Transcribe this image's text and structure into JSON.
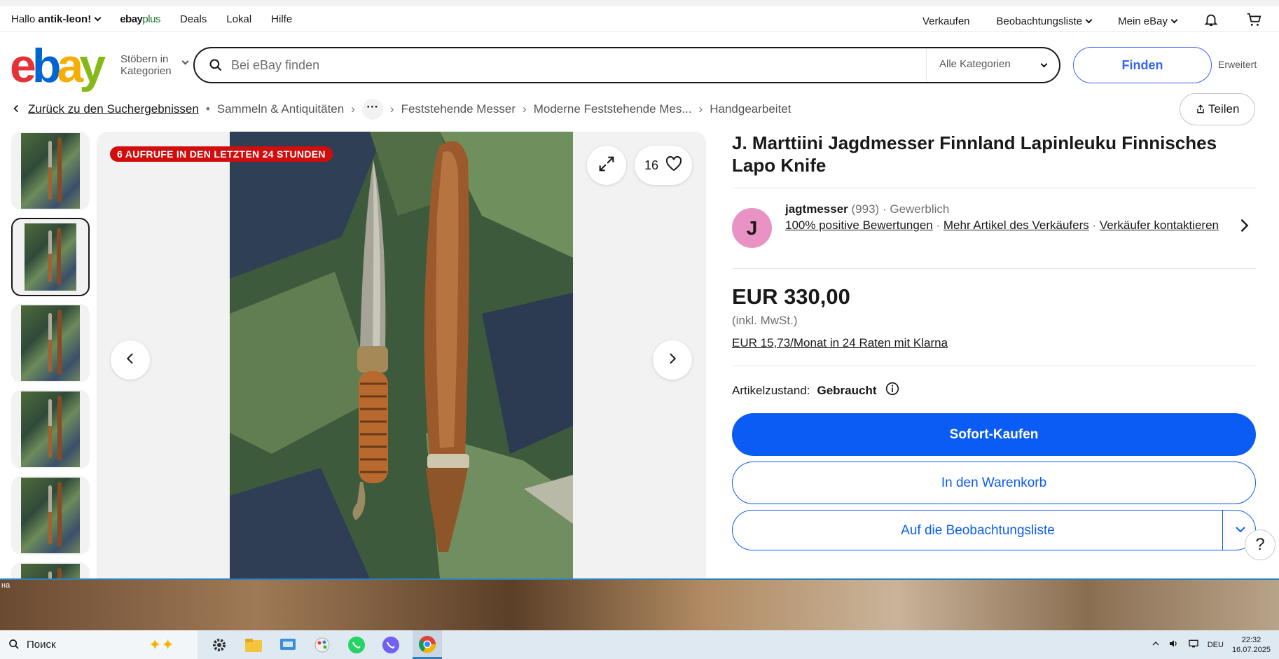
{
  "topbar": {
    "greeting": "Hallo",
    "username": "antik-leon!",
    "ebayplus": "ebay",
    "ebayplus_suffix": "plus",
    "links": [
      "Deals",
      "Lokal",
      "Hilfe"
    ],
    "sell": "Verkaufen",
    "watchlist": "Beobachtungsliste",
    "my_ebay": "Mein eBay"
  },
  "header": {
    "logo_letters": [
      "e",
      "b",
      "a",
      "y"
    ],
    "browse_line1": "Stöbern in",
    "browse_line2": "Kategorien",
    "search_placeholder": "Bei eBay finden",
    "category": "Alle Kategorien",
    "search_button": "Finden",
    "advanced": "Erweitert"
  },
  "breadcrumb": {
    "back": "Zurück zu den Suchergebnissen",
    "items": [
      "Sammeln & Antiquitäten",
      "Feststehende Messer",
      "Moderne Feststehende Mes...",
      "Handgearbeitet"
    ],
    "more": "···",
    "share": "Teilen"
  },
  "gallery": {
    "views_badge": "6 AUFRUFE IN DEN LETZTEN 24 STUNDEN",
    "watch_count": "16",
    "thumbnail_count": 6,
    "selected_thumbnail": 2
  },
  "listing": {
    "title": "J. Marttiini Jagdmesser Finnland Lapinleuku Finnisches Lapo Knife",
    "seller": {
      "initial": "J",
      "name": "jagtmesser",
      "rating_count": "(993)",
      "type": "Gewerblich",
      "feedback": "100% positive Bewertungen",
      "more_items": "Mehr Artikel des Verkäufers",
      "contact": "Verkäufer kontaktieren"
    },
    "price": "EUR 330,00",
    "vat": "(inkl. MwSt.)",
    "financing": "EUR 15,73/Monat in 24 Raten mit Klarna",
    "condition_label": "Artikelzustand:",
    "condition_value": "Gebraucht",
    "buy_now": "Sofort-Kaufen",
    "add_to_cart": "In den Warenkorb",
    "add_to_watchlist": "Auf die Beobachtungsliste",
    "help": "?"
  },
  "desktop": {
    "label": "на"
  },
  "taskbar": {
    "search": "Поиск",
    "language": "DEU",
    "time": "22:32",
    "date": "16.07.2025"
  },
  "colors": {
    "accent": "#0b5cf5",
    "badge": "#d20d0d",
    "avatar": "#e893c4"
  }
}
